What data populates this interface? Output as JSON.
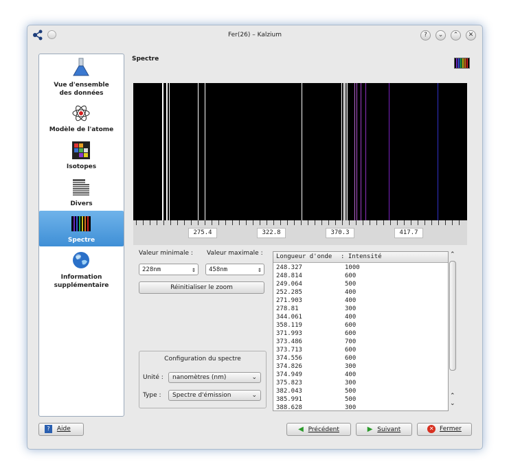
{
  "window": {
    "title": "Fer(26) – Kalzium"
  },
  "titlebar_buttons": [
    "?",
    "⌄",
    "⌃",
    "✕"
  ],
  "sidebar": {
    "items": [
      {
        "label_line1": "Vue d'ensemble",
        "label_line2": "des données",
        "icon": "flask-icon"
      },
      {
        "label_line1": "Modèle de l'atome",
        "label_line2": "",
        "icon": "atom-icon"
      },
      {
        "label_line1": "Isotopes",
        "label_line2": "",
        "icon": "isotopes-icon"
      },
      {
        "label_line1": "Divers",
        "label_line2": "",
        "icon": "misc-icon"
      },
      {
        "label_line1": "Spectre",
        "label_line2": "",
        "icon": "spectrum-icon",
        "active": true
      },
      {
        "label_line1": "Information",
        "label_line2": "supplémentaire",
        "icon": "globe-icon"
      }
    ]
  },
  "main": {
    "heading": "Spectre",
    "scale_labels": [
      "275.4",
      "322.8",
      "370.3",
      "417.7"
    ],
    "min_label": "Valeur minimale :",
    "max_label": "Valeur maximale :",
    "min_value": "228nm",
    "max_value": "458nm",
    "reset_zoom": "Réinitialiser le zoom",
    "config": {
      "title": "Configuration du spectre",
      "unit_label": "Unité :",
      "unit_value": "nanomètres (nm)",
      "type_label": "Type :",
      "type_value": "Spectre d'émission"
    },
    "table": {
      "headers": [
        "Longueur d'onde",
        "Intensité"
      ],
      "rows": [
        [
          "248.327",
          "1000"
        ],
        [
          "248.814",
          "600"
        ],
        [
          "249.064",
          "500"
        ],
        [
          "252.285",
          "400"
        ],
        [
          "271.903",
          "400"
        ],
        [
          "278.81",
          "300"
        ],
        [
          "344.061",
          "400"
        ],
        [
          "358.119",
          "600"
        ],
        [
          "371.993",
          "600"
        ],
        [
          "373.486",
          "700"
        ],
        [
          "373.713",
          "600"
        ],
        [
          "374.556",
          "600"
        ],
        [
          "374.826",
          "300"
        ],
        [
          "374.949",
          "400"
        ],
        [
          "375.823",
          "300"
        ],
        [
          "382.043",
          "500"
        ],
        [
          "385.991",
          "500"
        ],
        [
          "388.628",
          "300"
        ]
      ]
    }
  },
  "footer": {
    "help": "Aide",
    "previous": "Précédent",
    "next": "Suivant",
    "close": "Fermer"
  },
  "colors": {
    "accent": "#3f8fd6",
    "spectrum_bg": "#000000"
  }
}
